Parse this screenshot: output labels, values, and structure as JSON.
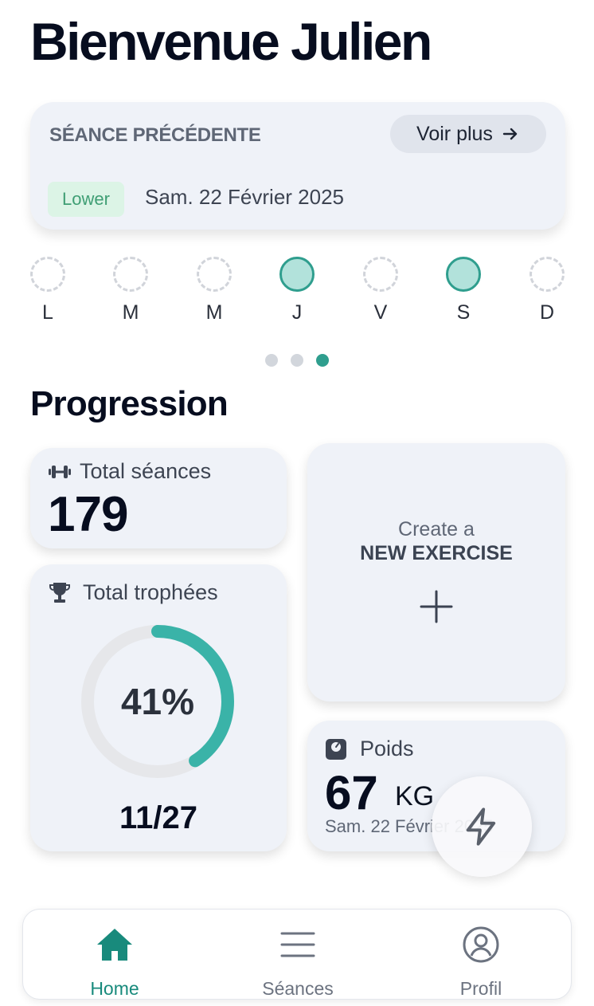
{
  "header": {
    "title": "Bienvenue Julien"
  },
  "previous_session": {
    "label": "SÉANCE PRÉCÉDENTE",
    "more_button": "Voir plus",
    "tag": "Lower",
    "date": "Sam. 22 Février 2025"
  },
  "week": {
    "days": [
      {
        "label": "L",
        "done": false
      },
      {
        "label": "M",
        "done": false
      },
      {
        "label": "M",
        "done": false
      },
      {
        "label": "J",
        "done": true
      },
      {
        "label": "V",
        "done": false
      },
      {
        "label": "S",
        "done": true
      },
      {
        "label": "D",
        "done": false
      }
    ],
    "pager_count": 3,
    "pager_active": 3
  },
  "progression": {
    "title": "Progression",
    "total_sessions": {
      "label": "Total séances",
      "value": "179",
      "icon": "dumbbell-icon"
    },
    "trophies": {
      "label": "Total trophées",
      "percent": "41%",
      "fraction": 0.41,
      "count": "11/27",
      "icon": "trophy-icon"
    },
    "create": {
      "line1": "Create a",
      "line2": "NEW EXERCISE",
      "icon": "plus-icon"
    },
    "weight": {
      "label": "Poids",
      "value": "67",
      "unit": "KG",
      "date": "Sam. 22 Février 2025",
      "icon": "scale-icon"
    }
  },
  "fab": {
    "icon": "lightning-icon"
  },
  "tabbar": {
    "items": [
      {
        "label": "Home",
        "icon": "home-icon",
        "active": true
      },
      {
        "label": "Séances",
        "icon": "menu-icon",
        "active": false
      },
      {
        "label": "Profil",
        "icon": "profile-icon",
        "active": false
      }
    ]
  },
  "colors": {
    "accent": "#2f9e8e",
    "accent_light": "#b2e2db",
    "card_bg": "#eff2f8",
    "tag_bg": "#dcf4e6",
    "tag_text": "#3f9e74"
  }
}
